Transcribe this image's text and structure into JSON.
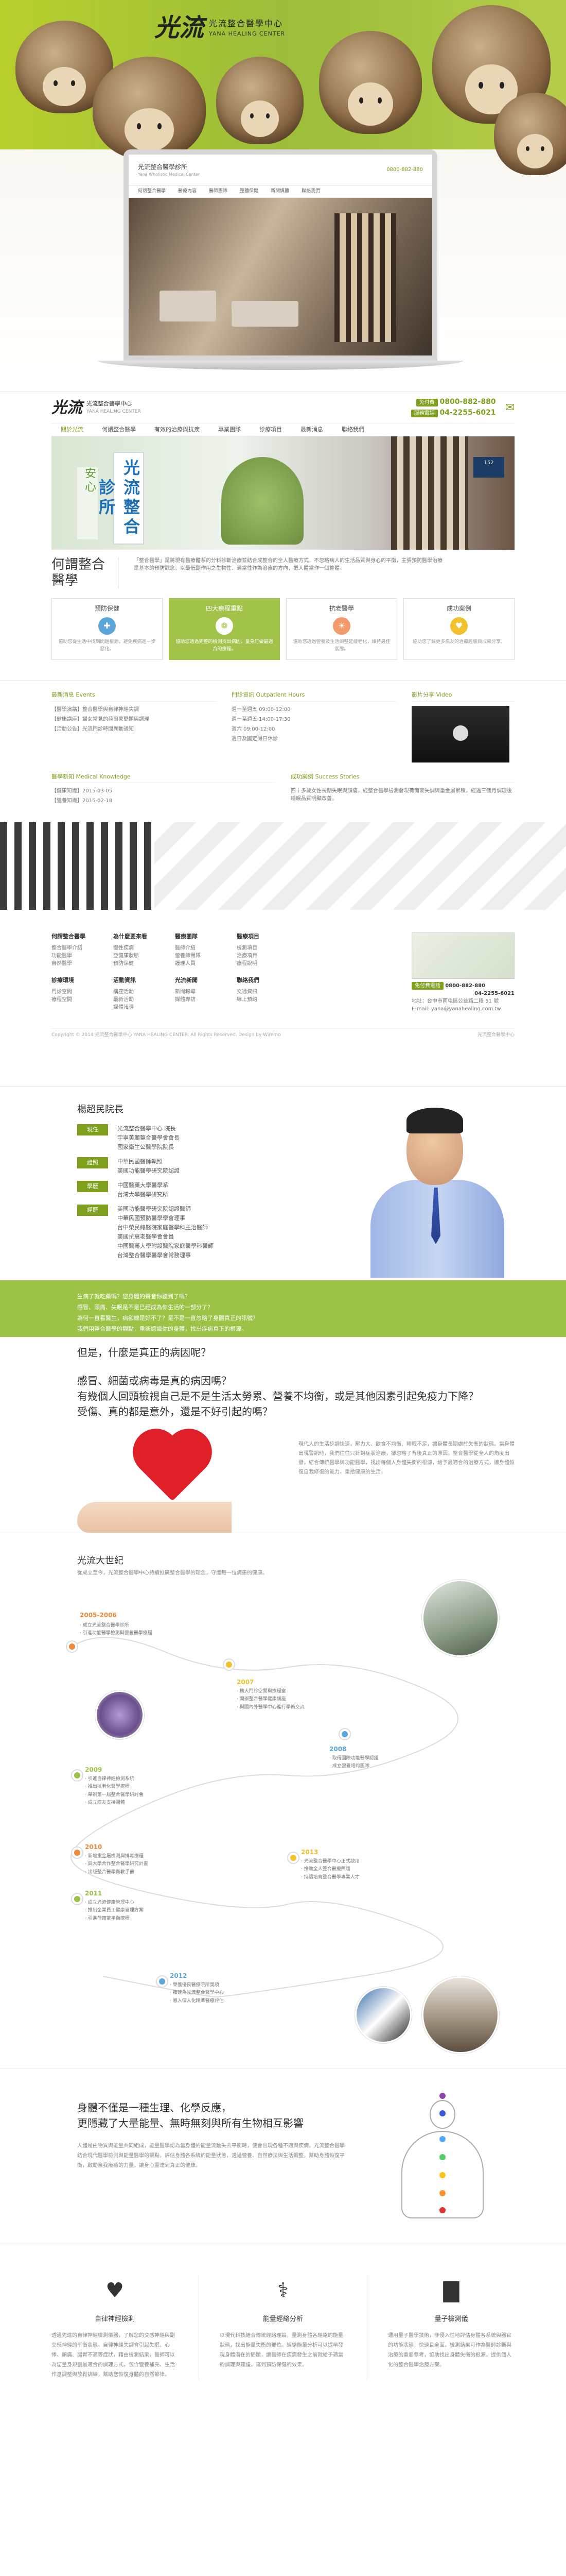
{
  "hero": {
    "logo_mark": "光流",
    "name_zh": "光流整合醫學中心",
    "name_en": "YANA HEALING CENTER"
  },
  "mockup": {
    "title": "光流整合醫學診所",
    "subtitle": "Yana Wholistic Medical Center",
    "phone": "0800-882-880",
    "nav": [
      "何謂整合醫學",
      "醫療內容",
      "醫師團隊",
      "整體保健",
      "新聞媒體",
      "聯絡我們"
    ]
  },
  "site": {
    "logo_mark": "光流",
    "name_zh": "光流整合醫學中心",
    "name_en": "YANA HEALING CENTER",
    "badge1": "免付費",
    "phone1": "0800-882-880",
    "badge2": "服務電話",
    "phone2": "04-2255-6021",
    "nav": [
      "關於光流",
      "何謂整合醫學",
      "有效的治療與抗疾",
      "專業團隊",
      "診療項目",
      "最新消息",
      "聯絡我們"
    ],
    "sign_main": "光流整合診所",
    "sign_side": "安心",
    "intro_title": "何謂整合醫學",
    "intro_text": "「整合醫學」是將現有醫療體系的分科診斷治療並結合成整合的全人醫療方式，不忽略病人的生活品質與身心的平衡，主張預防醫學治療是基本的預防觀念，以最低副作用之生物性、適當性作為治療的方向，把人體當作一個整體。",
    "cards": [
      {
        "title": "預防保健",
        "text": "協助您從生活中找到問題根源，避免疾病進一步惡化。",
        "color": "#5ba6d8",
        "icon": "✚"
      },
      {
        "title": "四大療程重點",
        "text": "協助您透過完整的檢測找出病因，量身訂做最適合的療程。",
        "color": "#ffffff",
        "icon": "❁"
      },
      {
        "title": "抗老醫學",
        "text": "協助您透過營養及生活調整延緩老化，維持最佳狀態。",
        "color": "#f39a6b",
        "icon": "☀"
      },
      {
        "title": "成功案例",
        "text": "協助您了解更多病友的治療經驗與成果分享。",
        "color": "#f2c12e",
        "icon": "♥"
      }
    ]
  },
  "info": {
    "news_title": "最新消息 Events",
    "news": [
      "【醫學演講】整合醫學與自律神經失調",
      "【健康講座】婦女常見的荷爾蒙問題與調理",
      "【活動公告】光流門診時間異動通知"
    ],
    "forum_title": "門診資訊 Outpatient Hours",
    "forum": [
      "週一至週五 09:00-12:00",
      "週一至週五 14:00-17:30",
      "週六 09:00-12:00",
      "週日及國定假日休診"
    ],
    "video_title": "影片分享 Video",
    "knowledge_title": "醫學新知 Medical Knowledge",
    "knowledge": [
      "【健康知識】2015-03-05",
      "【營養知識】2015-02-18"
    ],
    "cases_title": "成功案例 Success Stories",
    "case_text": "四十多歲女性長期失眠與頭痛，經整合醫學檢測發現荷爾蒙失調與重金屬累積，經過三個月調理後睡眠品質明顯改善。"
  },
  "footer": {
    "cols": [
      {
        "title": "何謂整合醫學",
        "items": [
          "整合醫學介紹",
          "功能醫學",
          "自然醫學"
        ]
      },
      {
        "title": "為什麼要來看",
        "items": [
          "慢性疾病",
          "亞健康狀態",
          "預防保健"
        ]
      },
      {
        "title": "醫療團隊",
        "items": [
          "醫師介紹",
          "營養師團隊",
          "護理人員"
        ]
      },
      {
        "title": "醫療項目",
        "items": [
          "檢測項目",
          "治療項目",
          "療程說明"
        ]
      },
      {
        "title": "診療環境",
        "items": [
          "門診空間",
          "療程空間"
        ]
      },
      {
        "title": "活動資訊",
        "items": [
          "講座活動",
          "最新活動",
          "媒體報導"
        ]
      },
      {
        "title": "光流新聞",
        "items": [
          "新聞報導",
          "媒體專訪"
        ]
      },
      {
        "title": "聯絡我們",
        "items": [
          "交通資訊",
          "線上預約"
        ]
      }
    ],
    "badge": "免付費電話",
    "phone1": "0800-882-880",
    "phone2": "04-2255-6021",
    "address": "地址：台中市南屯區公益路二段 51 號",
    "email": "E-mail: yana@yanahealing.com.tw",
    "copyright": "Copyright © 2014 光流整合醫學中心 YANA HEALING CENTER. All Rights Reserved. Design by Wiremo",
    "bottom_logo": "光流整合醫學中心"
  },
  "doctor": {
    "heading": "楊超民院長",
    "rows": [
      {
        "label": "現任",
        "value": "光流整合醫學中心 院長\n宇寧美麗整合醫學會會長\n國家衛生公醫學院院長"
      },
      {
        "label": "證照",
        "value": "中華民國醫師執照\n美國功能醫學研究院認證"
      },
      {
        "label": "學歷",
        "value": "中國醫藥大學醫學系\n台灣大學醫學研究所"
      },
      {
        "label": "經歷",
        "value": "美國功能醫學研究院認證醫師\n中華民國預防醫學學會理事\n台中榮民總醫院家庭醫學科主治醫師\n美國抗衰老醫學會會員\n中國醫藥大學附設醫院家庭醫學科醫師\n台灣整合醫學醫學會常務理事"
      }
    ],
    "band_lines": [
      "生病了就吃藥嗎？您身體的聲音你聽到了嗎？",
      "感冒、頭痛、失眠是不是已經成為你生活的一部分了？",
      "為何一直看醫生，病卻總是好不了？是不是一直忽略了身體真正的訊號？",
      "我們用整合醫學的觀點，重新認識你的身體，找出疾病真正的根源。"
    ],
    "q1": "但是，什麼是真正的病因呢？",
    "q2": "感冒、細菌或病毒是真的病因嗎？",
    "q3": "有幾個人回頭檢視自己是不是生活太勞累、營養不均衡，或是其他因素引起免疫力下降？",
    "q4": "受傷、真的都是意外，還是不好引起的嗎？"
  },
  "heart": {
    "text": "現代人的生活步調快速，壓力大、飲食不均衡、睡眠不足，讓身體長期處於失衡的狀態。當身體出現警訊時，我們往往只針對症狀治療，卻忽略了背後真正的原因。整合醫學從全人的角度出發，結合傳統醫學與功能醫學，找出每個人身體失衡的根源，給予最適合的治療方式，讓身體恢復自我修復的能力，重拾健康的生活。"
  },
  "timeline": {
    "title": "光流大世紀",
    "subtitle": "從成立至今，光流整合醫學中心持續推廣整合醫學的理念，守護每一位病患的健康。",
    "events": [
      {
        "year": "2005-2006",
        "color": "#f08a3c",
        "text": "‧ 成立光流整合醫學診所\n‧ 引進功能醫學檢測與營養醫學療程"
      },
      {
        "year": "2007",
        "color": "#f2c12e",
        "text": "‧ 擴大門診空間與療程室\n‧ 開辦整合醫學健康講座\n‧ 與國內外醫學中心進行學術交流"
      },
      {
        "year": "2008",
        "color": "#5ba6d8",
        "text": "‧ 取得國際功能醫學認證\n‧ 成立營養諮詢團隊"
      },
      {
        "year": "2009",
        "color": "#9cc346",
        "text": "‧ 引進自律神經檢測系統\n‧ 推出抗老化醫學療程\n‧ 舉辦第一屆整合醫學研討會\n‧ 成立病友支持團體"
      },
      {
        "year": "2010",
        "color": "#f08a3c",
        "text": "‧ 新增重金屬檢測與排毒療程\n‧ 與大學合作整合醫學研究計畫\n‧ 出版整合醫學衛教手冊"
      },
      {
        "year": "2011",
        "color": "#9cc346",
        "text": "‧ 成立光流健康管理中心\n‧ 推出企業員工健康管理方案\n‧ 引進荷爾蒙平衡療程"
      },
      {
        "year": "2012",
        "color": "#5ba6d8",
        "text": "‧ 榮獲優良醫療院所獎項\n‧ 擴建為光流整合醫學中心\n‧ 導入個人化精準醫療評估"
      },
      {
        "year": "2013",
        "color": "#f2c12e",
        "text": "‧ 光流整合醫學中心正式啟用\n‧ 推動全人整合醫療照護\n‧ 持續培育整合醫學專業人才"
      }
    ]
  },
  "chakra": {
    "line1": "身體不僅是一種生理、化學反應，",
    "line2": "更隱藏了大量能量、無時無刻與所有生物相互影響",
    "text": "人體是由物質與能量共同組成，能量醫學認為當身體的能量流動失去平衡時，便會出現各種不適與疾病。光流整合醫學結合現代醫學檢測與能量醫學的觀點，評估身體各系統的能量狀態，透過營養、自然療法與生活調整，幫助身體恢復平衡，啟動自我療癒的力量，讓身心靈達到真正的健康。",
    "dot_colors": [
      "#8e44ad",
      "#3b5bdb",
      "#4dabf7",
      "#51cf66",
      "#fcc419",
      "#ff922b",
      "#e03131"
    ]
  },
  "services": [
    {
      "icon": "heart-icon",
      "glyph": "♥",
      "title": "自律神經檢測",
      "text": "透過先進的自律神經檢測儀器，了解您的交感神經與副交感神經的平衡狀態。自律神經失調會引起失眠、心悸、頭痛、腸胃不適等症狀，藉由檢測結果，醫師可以為您量身規劃最適合的調理方式，包含營養補充、生活作息調整與放鬆訓練，幫助您恢復身體的自然節律。"
    },
    {
      "icon": "dna-icon",
      "glyph": "⚕",
      "title": "能量經絡分析",
      "text": "以現代科技結合傳統經絡理論，量測身體各經絡的能量狀態，找出能量失衡的部位。經絡能量分析可以提早發現身體潛在的問題，讓醫師在疾病發生之前就給予適當的調理與建議，達到預防保健的效果。"
    },
    {
      "icon": "chart-bars-icon",
      "glyph": "▇",
      "title": "量子檢測儀",
      "text": "運用量子醫學技術，非侵入性地評估身體各系統與器官的功能狀態，快速且全面。檢測結果可作為醫師診斷與治療的重要參考，協助找出身體失衡的根源，提供個人化的整合醫學治療方案。"
    }
  ]
}
